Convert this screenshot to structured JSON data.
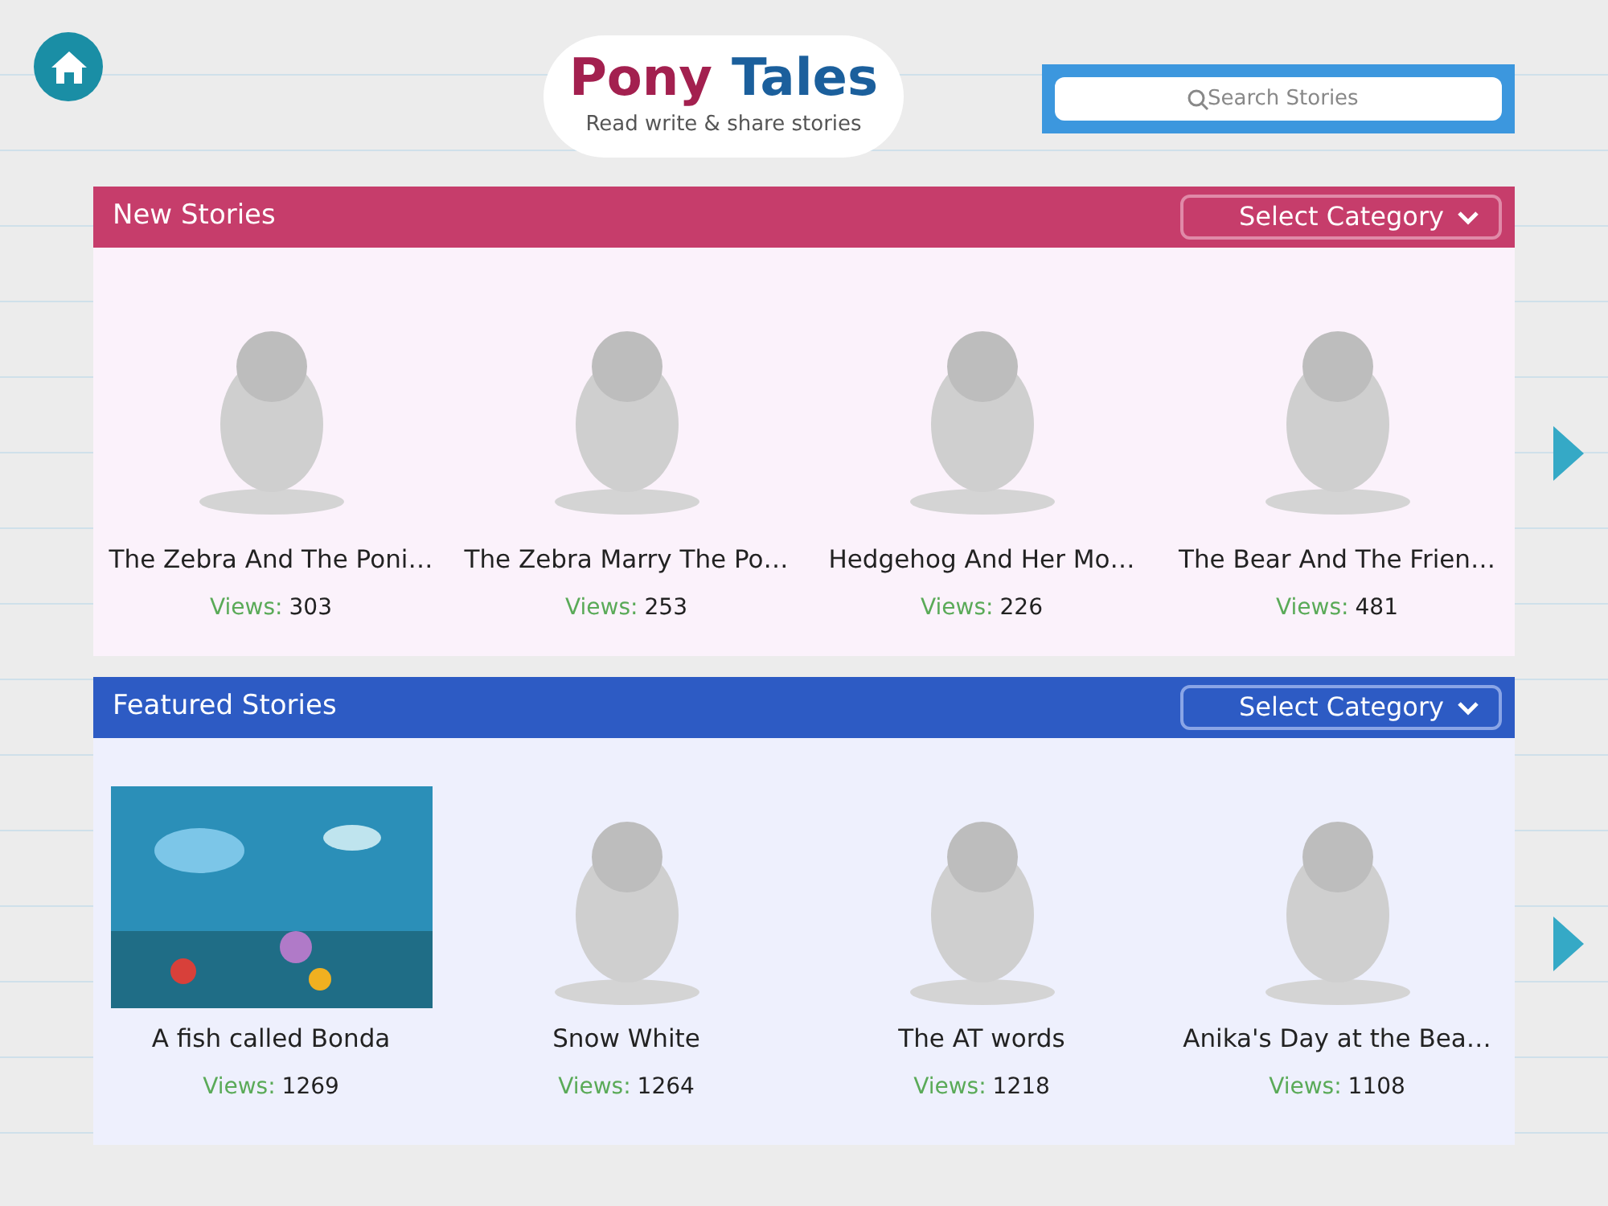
{
  "logo": {
    "word_1": "Pony",
    "word_2": "Tales",
    "tagline": "Read write & share stories"
  },
  "search": {
    "placeholder": "Search Stories"
  },
  "sections": [
    {
      "title": "New Stories",
      "kind": "new",
      "dropdown": "Select Category",
      "stories": [
        {
          "title": "The Zebra And The Poni…",
          "views_label": "Views:",
          "views": "303",
          "kind": "drawing"
        },
        {
          "title": "The Zebra Marry The Po…",
          "views_label": "Views:",
          "views": "253",
          "kind": "drawing"
        },
        {
          "title": "Hedgehog And Her Mo…",
          "views_label": "Views:",
          "views": "226",
          "kind": "drawing"
        },
        {
          "title": "The Bear And The Frien…",
          "views_label": "Views:",
          "views": "481",
          "kind": "drawing"
        }
      ]
    },
    {
      "title": "Featured Stories",
      "kind": "featured",
      "dropdown": "Select Category",
      "stories": [
        {
          "title": "A fish called Bonda",
          "views_label": "Views:",
          "views": "1269",
          "kind": "scene"
        },
        {
          "title": "Snow White",
          "views_label": "Views:",
          "views": "1264",
          "kind": "drawing"
        },
        {
          "title": "The AT words",
          "views_label": "Views:",
          "views": "1218",
          "kind": "drawing"
        },
        {
          "title": "Anika's Day at the Bea…",
          "views_label": "Views:",
          "views": "1108",
          "kind": "drawing"
        }
      ]
    }
  ]
}
